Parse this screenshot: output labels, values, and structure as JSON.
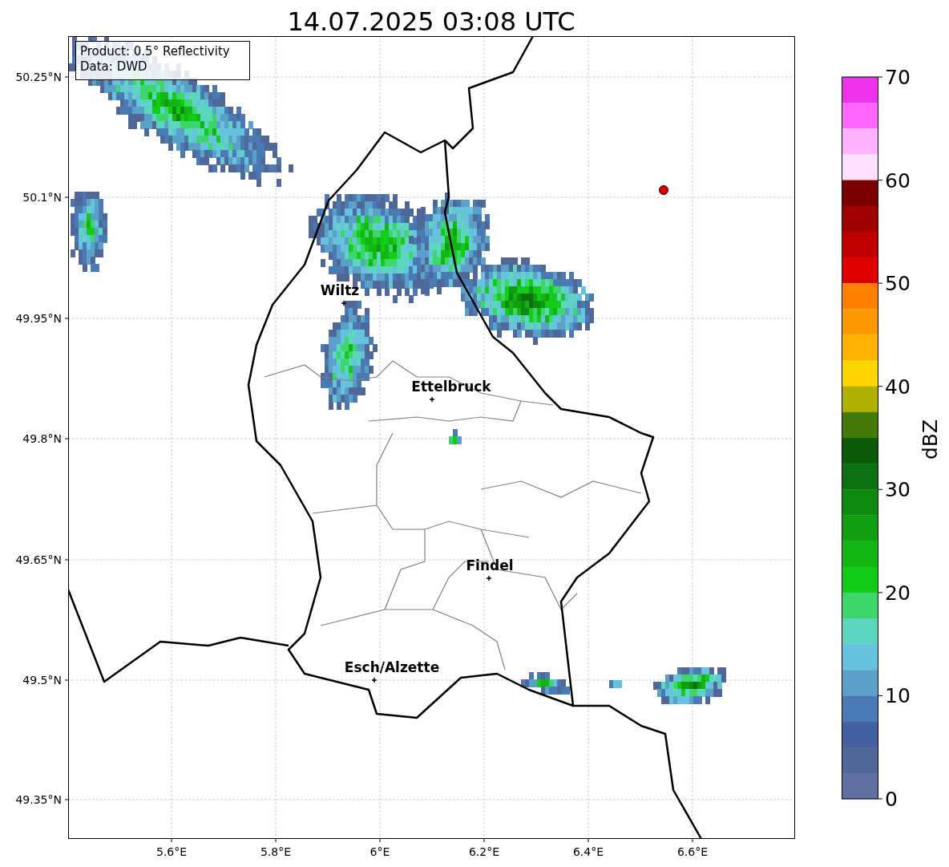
{
  "title": "14.07.2025 03:08 UTC",
  "info_box": [
    "Product: 0.5° Reflectivity",
    "Data: DWD"
  ],
  "x_ticks": [
    "5.6°E",
    "5.8°E",
    "6°E",
    "6.2°E",
    "6.4°E",
    "6.6°E"
  ],
  "y_ticks": [
    "50.25°N",
    "50.1°N",
    "49.95°N",
    "49.8°N",
    "49.65°N",
    "49.5°N",
    "49.35°N"
  ],
  "cities": [
    {
      "name": "Wiltz"
    },
    {
      "name": "Ettelbruck"
    },
    {
      "name": "Findel"
    },
    {
      "name": "Esch/Alzette"
    }
  ],
  "colorbar": {
    "label": "dBZ",
    "ticks": [
      "70",
      "60",
      "50",
      "40",
      "30",
      "20",
      "10",
      "0"
    ],
    "bins": [
      {
        "color": "#ee33ee"
      },
      {
        "color": "#ff66ff"
      },
      {
        "color": "#ffb3ff"
      },
      {
        "color": "#ffe0ff"
      },
      {
        "color": "#7a0000"
      },
      {
        "color": "#a00000"
      },
      {
        "color": "#c00000"
      },
      {
        "color": "#e00000"
      },
      {
        "color": "#ff8000"
      },
      {
        "color": "#ff9900"
      },
      {
        "color": "#ffb300"
      },
      {
        "color": "#ffd700"
      },
      {
        "color": "#b0b000"
      },
      {
        "color": "#457a0a"
      },
      {
        "color": "#0a5a0a"
      },
      {
        "color": "#0b7010"
      },
      {
        "color": "#0f8a10"
      },
      {
        "color": "#109e10"
      },
      {
        "color": "#12b512"
      },
      {
        "color": "#12cc18"
      },
      {
        "color": "#3dd66b"
      },
      {
        "color": "#5dd6c0"
      },
      {
        "color": "#66c2dd"
      },
      {
        "color": "#5ba0c8"
      },
      {
        "color": "#4a7ab4"
      },
      {
        "color": "#4560a0"
      },
      {
        "color": "#506898"
      },
      {
        "color": "#6070a0"
      }
    ]
  }
}
